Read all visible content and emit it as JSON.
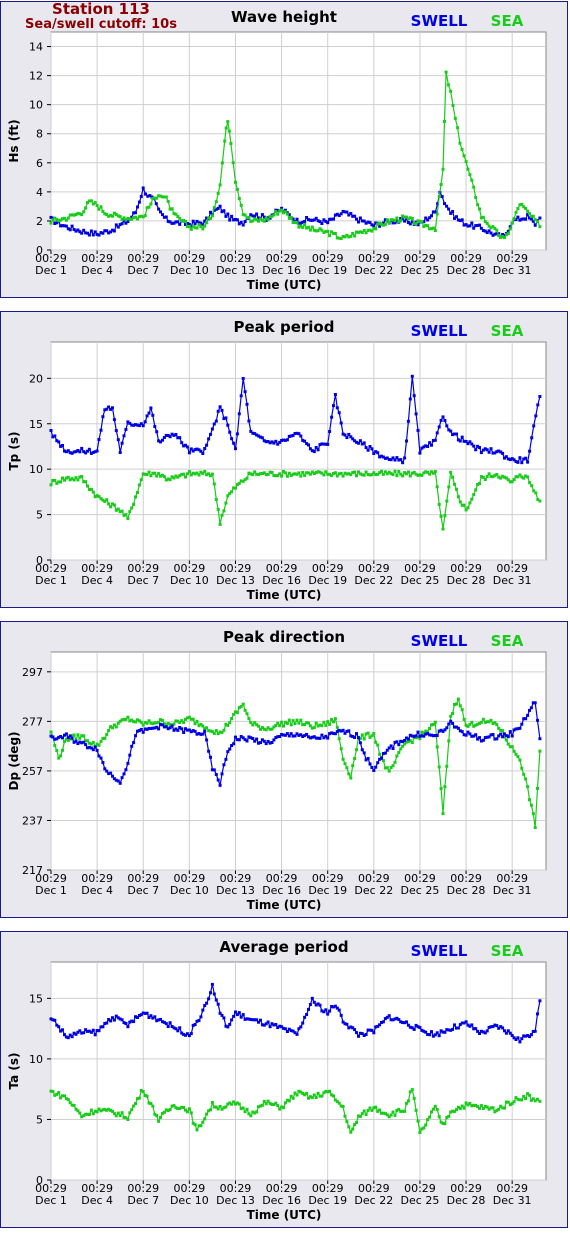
{
  "station": {
    "name": "Station 113",
    "cutoff": "Sea/swell cutoff: 10s"
  },
  "legend": {
    "swell": "SWELL",
    "sea": "SEA"
  },
  "colors": {
    "swell": "#0000e6",
    "sea": "#19cc19",
    "grid": "#cfcfcf",
    "station": "#8b0000"
  },
  "x_tick_labels": [
    {
      "time": "00:29",
      "date": "Dec 1"
    },
    {
      "time": "00:29",
      "date": "Dec 4"
    },
    {
      "time": "00:29",
      "date": "Dec 7"
    },
    {
      "time": "00:29",
      "date": "Dec 10"
    },
    {
      "time": "00:29",
      "date": "Dec 13"
    },
    {
      "time": "00:29",
      "date": "Dec 16"
    },
    {
      "time": "00:29",
      "date": "Dec 19"
    },
    {
      "time": "00:29",
      "date": "Dec 22"
    },
    {
      "time": "00:29",
      "date": "Dec 25"
    },
    {
      "time": "00:29",
      "date": "Dec 28"
    },
    {
      "time": "00:29",
      "date": "Dec 31"
    }
  ],
  "chart_data": [
    {
      "type": "line",
      "title": "Wave height",
      "xlabel": "Time (UTC)",
      "ylabel": "Hs (ft)",
      "ylim": [
        0,
        15
      ],
      "yticks": [
        0,
        2,
        4,
        6,
        8,
        10,
        12,
        14
      ],
      "x_unit": "days since Dec 1 00:29",
      "grid": true,
      "legend_position": "top-right",
      "series": [
        {
          "name": "SWELL",
          "x": [
            0,
            1,
            2,
            3,
            4,
            5,
            5.5,
            6,
            6.3,
            6.7,
            7,
            7.5,
            8,
            9,
            10,
            10.5,
            11,
            11.5,
            12,
            12.5,
            13,
            14,
            15,
            16,
            17,
            18,
            19,
            20,
            21,
            22,
            23,
            24,
            25,
            25.3,
            25.6,
            26,
            26.5,
            27,
            28,
            29,
            29.5,
            30,
            31,
            31.5,
            31.8
          ],
          "y": [
            2.1,
            1.6,
            1.3,
            1.1,
            1.4,
            2.0,
            2.6,
            4.2,
            3.8,
            3.4,
            2.7,
            2.1,
            1.9,
            1.8,
            1.9,
            2.6,
            2.9,
            2.3,
            2.0,
            1.9,
            2.5,
            2.2,
            2.8,
            2.0,
            2.1,
            1.9,
            2.6,
            2.1,
            1.7,
            2.0,
            2.0,
            1.8,
            2.6,
            4.1,
            3.3,
            2.6,
            2.1,
            1.8,
            1.5,
            1.0,
            0.9,
            2.0,
            2.3,
            1.8,
            2.2
          ]
        },
        {
          "name": "SEA",
          "x": [
            0,
            1,
            2,
            2.5,
            3,
            3.5,
            4,
            5,
            6,
            6.5,
            7,
            7.5,
            8,
            9,
            10,
            10.5,
            11,
            11.3,
            11.5,
            11.7,
            12,
            12.5,
            13,
            14,
            15,
            16,
            17,
            18,
            19,
            20,
            21,
            22,
            23,
            24,
            25,
            25.5,
            25.7,
            26,
            26.3,
            26.6,
            27,
            27.5,
            28,
            29,
            29.5,
            30,
            30.5,
            31,
            31.5,
            31.8
          ],
          "y": [
            2.0,
            2.2,
            2.6,
            3.3,
            3.1,
            2.6,
            2.4,
            2.2,
            2.3,
            3.2,
            3.9,
            3.5,
            2.4,
            1.6,
            1.6,
            2.5,
            4.5,
            7.5,
            9.0,
            7.5,
            4.8,
            2.6,
            2.0,
            2.1,
            2.8,
            1.8,
            1.4,
            1.2,
            0.8,
            1.2,
            1.5,
            2.0,
            2.2,
            1.8,
            1.5,
            5.5,
            12.1,
            10.8,
            9.0,
            7.5,
            6.0,
            4.2,
            2.3,
            1.2,
            0.7,
            1.8,
            3.2,
            2.6,
            2.0,
            1.6
          ]
        }
      ]
    },
    {
      "type": "line",
      "title": "Peak period",
      "xlabel": "Time (UTC)",
      "ylabel": "Tp (s)",
      "ylim": [
        0,
        24
      ],
      "yticks": [
        0,
        5,
        10,
        15,
        20
      ],
      "x_unit": "days since Dec 1 00:29",
      "grid": true,
      "legend_position": "top-right",
      "series": [
        {
          "name": "SWELL",
          "x": [
            0,
            1,
            2,
            3,
            3.5,
            4,
            4.5,
            5,
            6,
            6.5,
            7,
            8,
            9,
            10,
            11,
            11.5,
            12,
            12.5,
            13,
            14,
            15,
            16,
            17,
            18,
            18.5,
            19,
            20,
            21,
            22,
            23,
            23.5,
            24,
            25,
            25.5,
            26,
            27,
            28,
            29,
            30,
            31,
            31.8
          ],
          "y": [
            14,
            12,
            12,
            12,
            16.7,
            16.7,
            12,
            15,
            15,
            16.7,
            13,
            14,
            12,
            12,
            16.7,
            15,
            12,
            20,
            14,
            13,
            13,
            14,
            12,
            13,
            18,
            14,
            13,
            12,
            11,
            11,
            20,
            12,
            13,
            16,
            14,
            13,
            12,
            12,
            11,
            11,
            18
          ]
        },
        {
          "name": "SEA",
          "x": [
            0,
            1,
            2,
            3,
            3.5,
            4,
            4.5,
            5,
            6,
            6.5,
            7,
            7.5,
            8,
            9,
            10,
            10.5,
            11,
            11.5,
            12,
            13,
            14,
            15,
            16,
            17,
            18,
            19,
            20,
            21,
            22,
            23,
            24,
            25,
            25.5,
            26,
            26.5,
            27,
            28,
            29,
            30,
            30.5,
            31,
            31.8
          ],
          "y": [
            8.5,
            9,
            9,
            7,
            6.5,
            6,
            5.5,
            4.5,
            9.5,
            9.5,
            9.5,
            9,
            9,
            9.5,
            9.5,
            9.5,
            4.2,
            7,
            8,
            9.5,
            9.5,
            9.5,
            9.5,
            9.5,
            9.5,
            9.5,
            9.5,
            9.5,
            9.5,
            9.5,
            9.5,
            9.5,
            3.2,
            9.5,
            7,
            5.5,
            9,
            9.5,
            8.5,
            9.5,
            9,
            6.5
          ]
        }
      ]
    },
    {
      "type": "line",
      "title": "Peak direction",
      "xlabel": "Time (UTC)",
      "ylabel": "Dp (deg)",
      "ylim": [
        217,
        305
      ],
      "yticks": [
        217,
        237,
        257,
        277,
        297
      ],
      "x_unit": "days since Dec 1 00:29",
      "grid": true,
      "legend_position": "top-right",
      "series": [
        {
          "name": "SWELL",
          "x": [
            0,
            1,
            2,
            3,
            3.5,
            4,
            4.5,
            5,
            5.5,
            6,
            7,
            8,
            9,
            10,
            10.5,
            11,
            11.5,
            12,
            13,
            14,
            15,
            16,
            17,
            18,
            19,
            20,
            20.5,
            21,
            22,
            23,
            24,
            25,
            26,
            27,
            28,
            29,
            30,
            30.5,
            31,
            31.5,
            31.8
          ],
          "y": [
            270,
            271,
            268,
            266,
            258,
            255,
            253,
            260,
            272,
            273,
            275,
            274,
            273,
            272,
            258,
            252,
            265,
            270,
            270,
            268,
            271,
            272,
            270,
            271,
            273,
            271,
            262,
            258,
            266,
            270,
            272,
            271,
            276,
            272,
            270,
            271,
            272,
            275,
            280,
            285,
            270
          ]
        },
        {
          "name": "SEA",
          "x": [
            0,
            0.5,
            1,
            2,
            3,
            4,
            5,
            6,
            7,
            8,
            9,
            10,
            11,
            12,
            12.5,
            13,
            14,
            15,
            16,
            17,
            18,
            18.5,
            19,
            19.5,
            20,
            21,
            21.5,
            22,
            23,
            24,
            25,
            25.5,
            26,
            26.5,
            27,
            28,
            29,
            30,
            30.5,
            31,
            31.5,
            31.8
          ],
          "y": [
            273,
            262,
            270,
            271,
            267,
            275,
            278,
            276,
            277,
            276,
            278,
            275,
            272,
            280,
            284,
            276,
            274,
            276,
            277,
            275,
            276,
            278,
            262,
            255,
            270,
            272,
            262,
            256,
            268,
            271,
            276,
            240,
            279,
            287,
            275,
            277,
            276,
            266,
            262,
            250,
            235,
            265
          ]
        }
      ]
    },
    {
      "type": "line",
      "title": "Average period",
      "xlabel": "Time (UTC)",
      "ylabel": "Ta (s)",
      "ylim": [
        0,
        18
      ],
      "yticks": [
        0,
        5,
        10,
        15
      ],
      "x_unit": "days since Dec 1 00:29",
      "grid": true,
      "legend_position": "top-right",
      "series": [
        {
          "name": "SWELL",
          "x": [
            0,
            1,
            2,
            3,
            4,
            5,
            6,
            7,
            8,
            9,
            10,
            10.5,
            11,
            11.5,
            12,
            13,
            14,
            15,
            16,
            17,
            18,
            18.5,
            19,
            20,
            21,
            22,
            23,
            24,
            25,
            26,
            27,
            28,
            29,
            30,
            30.5,
            31,
            31.5,
            31.8
          ],
          "y": [
            13.5,
            11.8,
            12.2,
            12.2,
            13.5,
            12.8,
            13.8,
            13.3,
            12.6,
            12.0,
            14.2,
            16.0,
            13.8,
            12.6,
            13.8,
            13.2,
            12.9,
            12.5,
            12.0,
            14.8,
            13.8,
            14.5,
            13.2,
            12.0,
            12.3,
            13.5,
            13.0,
            12.4,
            12.0,
            12.5,
            12.9,
            12.1,
            12.7,
            12.0,
            11.5,
            12.0,
            12.2,
            14.8
          ]
        },
        {
          "name": "SEA",
          "x": [
            0,
            1,
            2,
            3,
            4,
            5,
            6,
            7,
            8,
            9,
            9.5,
            10,
            10.5,
            11,
            12,
            13,
            14,
            15,
            16,
            17,
            18,
            19,
            19.5,
            20,
            21,
            22,
            23,
            23.5,
            24,
            25,
            25.5,
            26,
            27,
            28,
            29,
            30,
            31,
            31.5,
            31.8
          ],
          "y": [
            7.3,
            6.8,
            5.3,
            5.8,
            5.6,
            5.2,
            7.5,
            5.0,
            6.2,
            5.8,
            4.0,
            5.2,
            6.2,
            6.0,
            6.3,
            5.5,
            6.4,
            6.0,
            7.2,
            6.8,
            7.3,
            6.0,
            3.8,
            5.2,
            6.0,
            5.4,
            5.8,
            7.5,
            3.8,
            6.0,
            4.5,
            5.7,
            6.2,
            6.0,
            5.8,
            6.5,
            7.0,
            6.5,
            6.5
          ]
        }
      ]
    }
  ]
}
